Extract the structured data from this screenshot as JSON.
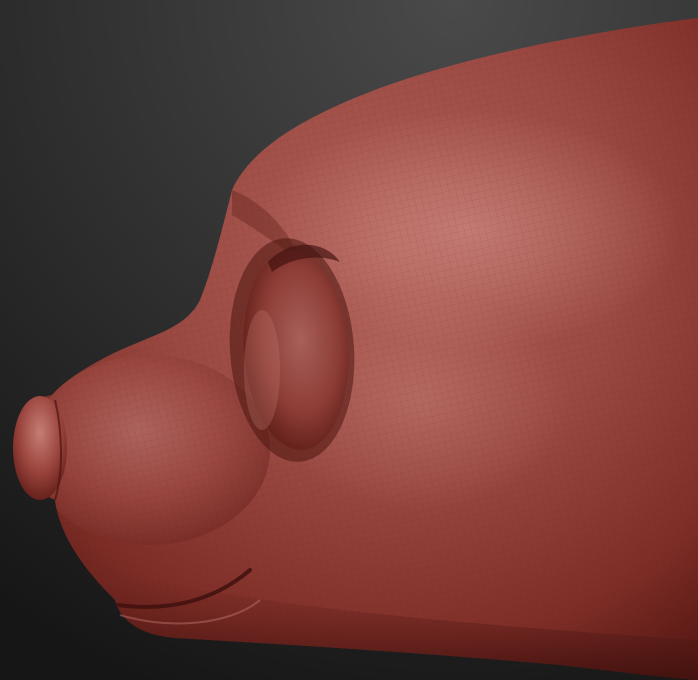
{
  "scene": {
    "subject": "sculpted-creature-head-side-view",
    "colors": {
      "background_top": "#4a4a4a",
      "background_bottom": "#161616",
      "skin_light": "#b86a62",
      "skin_mid": "#9c4038",
      "skin_dark": "#6a211c",
      "skin_shadow": "#3f110e",
      "highlight": "#d08c84"
    }
  }
}
